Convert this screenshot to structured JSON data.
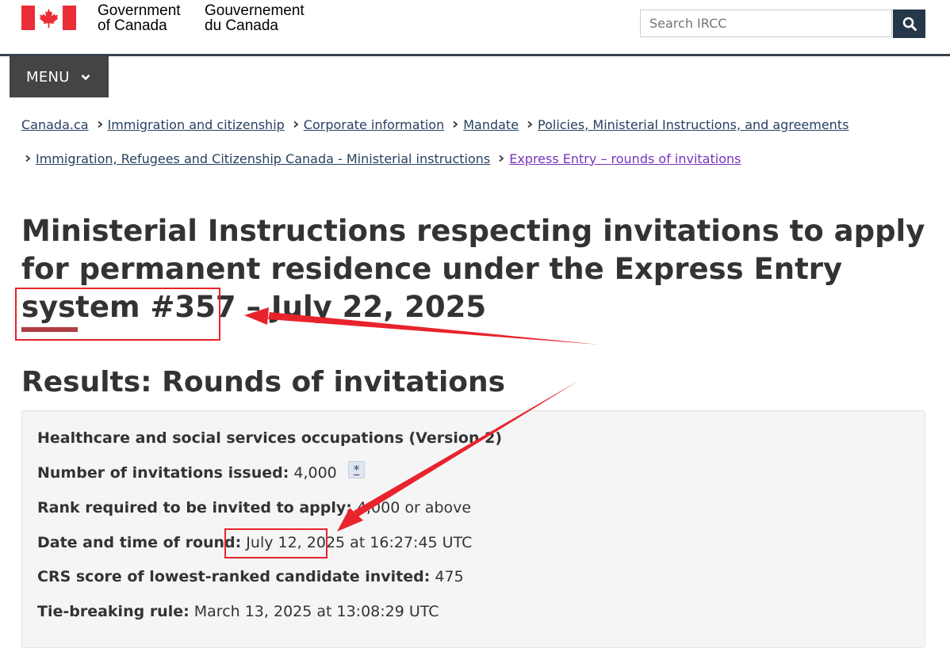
{
  "header": {
    "government_en": [
      "Government",
      "of Canada"
    ],
    "government_fr": [
      "Gouvernement",
      "du Canada"
    ],
    "search_placeholder": "Search IRCC"
  },
  "menu": {
    "label": "MENU"
  },
  "breadcrumbs": [
    "Canada.ca",
    "Immigration and citizenship",
    "Corporate information",
    "Mandate",
    "Policies, Ministerial Instructions, and agreements",
    "Immigration, Refugees and Citizenship Canada - Ministerial instructions",
    "Express Entry – rounds of invitations"
  ],
  "page": {
    "title": "Ministerial Instructions respecting invitations to apply for permanent residence under the Express Entry system #357 – July 22, 2025",
    "section_heading": "Results: Rounds of invitations"
  },
  "results": {
    "category": "Healthcare and social services occupations (Version 2)",
    "invitations_label": "Number of invitations issued:",
    "invitations_value": "4,000",
    "footnote_link": "*",
    "rank_label": "Rank required to be invited to apply:",
    "rank_value": "4,000 or above",
    "date_label": "Date and time of round:",
    "date_value": "July 12, 2025",
    "time_value": "at 16:27:45 UTC",
    "crs_label": "CRS score of lowest-ranked candidate invited:",
    "crs_value": "475",
    "tie_label": "Tie-breaking rule:",
    "tie_value": "March 13, 2025 at 13:08:29 UTC"
  },
  "colors": {
    "link": "#284162",
    "visited_link": "#7834bc",
    "annotation_red": "#e8232c",
    "search_button": "#26374a",
    "menu_bg": "#444444",
    "flag_red": "#eb2d37"
  }
}
